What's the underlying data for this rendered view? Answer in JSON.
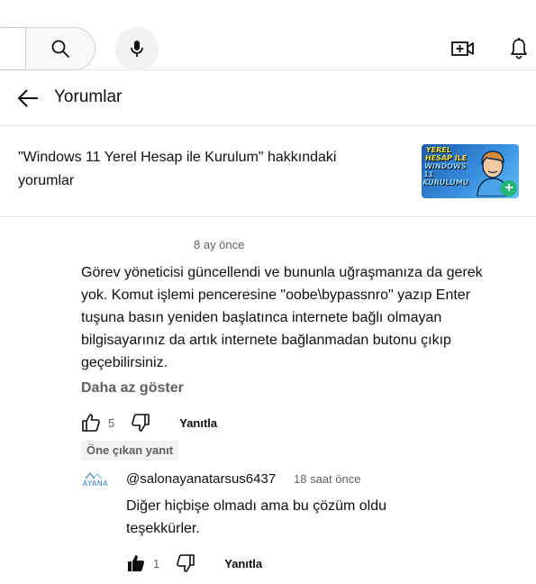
{
  "panel": {
    "title": "Yorumlar"
  },
  "video": {
    "title": "\"Windows 11 Yerel Hesap ile Kurulum\" hakkındaki yorumlar",
    "thumbnail_text": [
      "YEREL",
      "HESAP İLE",
      "WINDOWS 11",
      "KURULUMU"
    ]
  },
  "comment": {
    "time": "8 ay önce",
    "text": "Görev yöneticisi güncellendi ve bununla uğraşmanıza da gerek yok. Komut işlemi penceresine \"oobe\\bypassnro\" yazıp Enter tuşuna basın yeniden başlatınca internete bağlı olmayan bilgisayarınız da artık internete bağlanmadan butonu çıkıp geçebilirsiniz.",
    "show_less_label": "Daha az göster",
    "like_count": "5",
    "reply_label": "Yanıtla",
    "highlight_label": "Öne çıkan yanıt"
  },
  "reply": {
    "avatar_text": "AYANA",
    "author": "@salonayanatarsus6437",
    "time": "18 saat önce",
    "text": "Diğer hiçbişe olmadı ama bu çözüm oldu teşekkürler.",
    "like_count": "1",
    "reply_label": "Yanıtla",
    "liked": true
  },
  "icons": {
    "search": "search-icon",
    "mic": "mic-icon",
    "create": "video-add-icon",
    "bell": "bell-icon",
    "back": "arrow-left-icon",
    "like": "thumbs-up-icon",
    "dislike": "thumbs-down-icon"
  }
}
